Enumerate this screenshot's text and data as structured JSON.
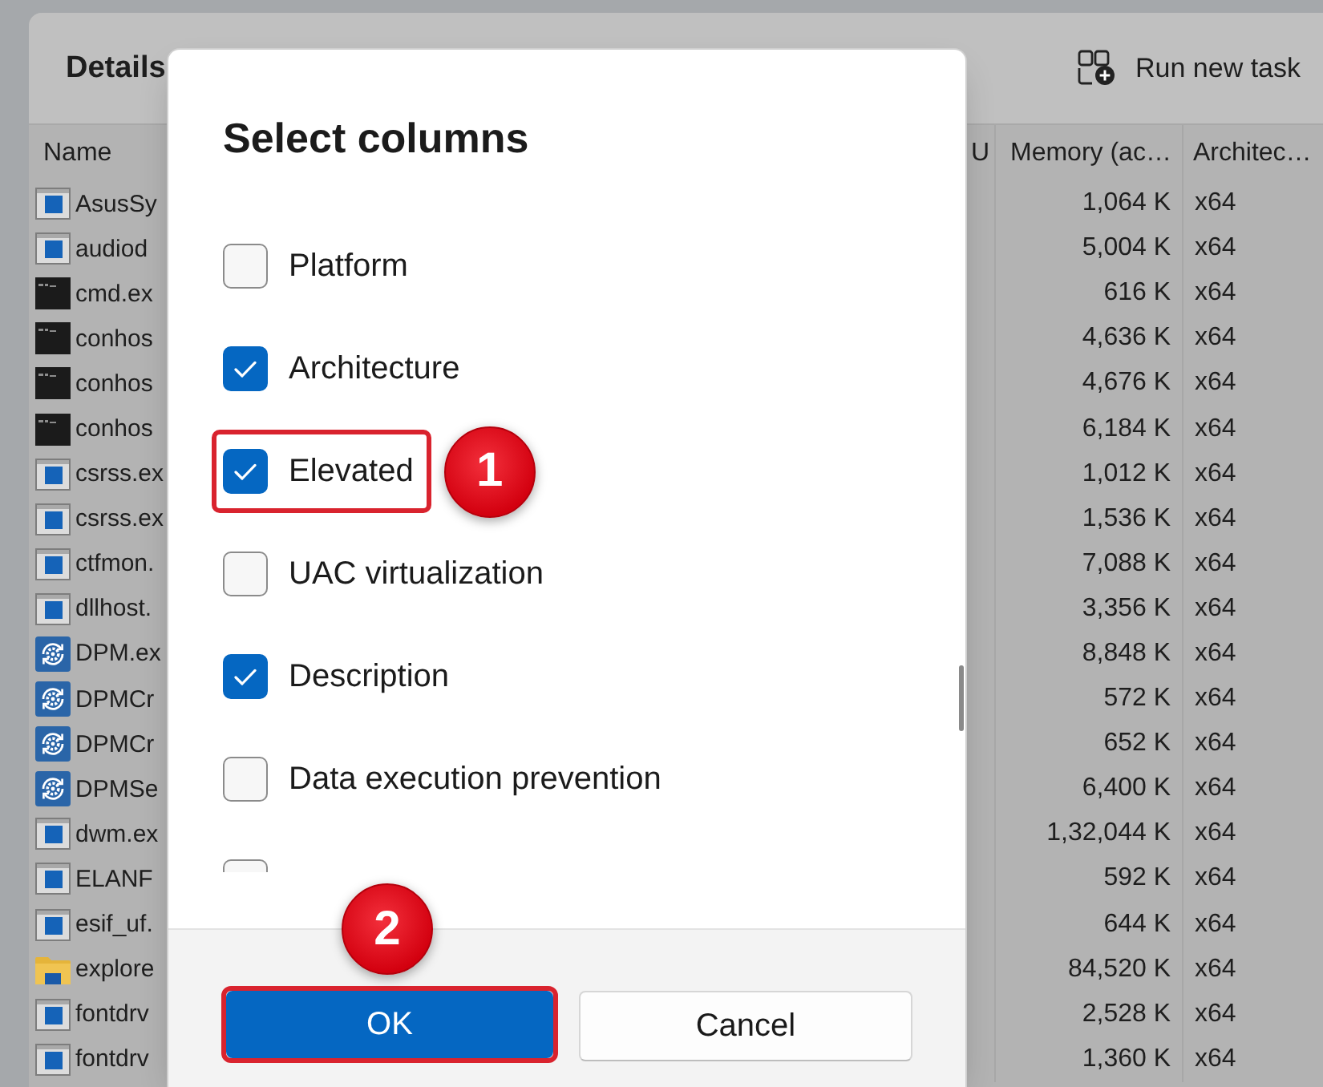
{
  "window": {
    "title": "Details",
    "toolbar": [
      {
        "label": "Run new task"
      }
    ]
  },
  "table": {
    "columns": [
      "Name",
      "U",
      "Memory (ac…",
      "Architec…"
    ],
    "rows": [
      {
        "kind": "app",
        "name": "AsusSy",
        "memory": "1,064 K",
        "architecture": "x64"
      },
      {
        "kind": "app",
        "name": "audiod",
        "memory": "5,004 K",
        "architecture": "x64"
      },
      {
        "kind": "console",
        "name": "cmd.ex",
        "memory": "616 K",
        "architecture": "x64"
      },
      {
        "kind": "console",
        "name": "conhos",
        "memory": "4,636 K",
        "architecture": "x64"
      },
      {
        "kind": "console",
        "name": "conhos",
        "memory": "4,676 K",
        "architecture": "x64"
      },
      {
        "kind": "console",
        "name": "conhos",
        "memory": "6,184 K",
        "architecture": "x64"
      },
      {
        "kind": "app",
        "name": "csrss.ex",
        "memory": "1,012 K",
        "architecture": "x64"
      },
      {
        "kind": "app",
        "name": "csrss.ex",
        "memory": "1,536 K",
        "architecture": "x64"
      },
      {
        "kind": "app",
        "name": "ctfmon.",
        "memory": "7,088 K",
        "architecture": "x64"
      },
      {
        "kind": "app",
        "name": "dllhost.",
        "memory": "3,356 K",
        "architecture": "x64"
      },
      {
        "kind": "service",
        "name": "DPM.ex",
        "memory": "8,848 K",
        "architecture": "x64"
      },
      {
        "kind": "service",
        "name": "DPMCr",
        "memory": "572 K",
        "architecture": "x64"
      },
      {
        "kind": "service",
        "name": "DPMCr",
        "memory": "652 K",
        "architecture": "x64"
      },
      {
        "kind": "service",
        "name": "DPMSe",
        "memory": "6,400 K",
        "architecture": "x64"
      },
      {
        "kind": "app",
        "name": "dwm.ex",
        "memory": "1,32,044 K",
        "architecture": "x64"
      },
      {
        "kind": "app",
        "name": "ELANF",
        "memory": "592 K",
        "architecture": "x64"
      },
      {
        "kind": "app",
        "name": "esif_uf.",
        "memory": "644 K",
        "architecture": "x64"
      },
      {
        "kind": "folder",
        "name": "explore",
        "memory": "84,520 K",
        "architecture": "x64"
      },
      {
        "kind": "app",
        "name": "fontdrv",
        "memory": "2,528 K",
        "architecture": "x64"
      },
      {
        "kind": "app",
        "name": "fontdrv",
        "memory": "1,360 K",
        "architecture": "x64"
      }
    ]
  },
  "dialog": {
    "title": "Select columns",
    "options": [
      {
        "label": "Platform",
        "checked": false,
        "highlighted": false
      },
      {
        "label": "Architecture",
        "checked": true,
        "highlighted": false
      },
      {
        "label": "Elevated",
        "checked": true,
        "highlighted": true,
        "callout": "1"
      },
      {
        "label": "UAC virtualization",
        "checked": false,
        "highlighted": false
      },
      {
        "label": "Description",
        "checked": true,
        "highlighted": false
      },
      {
        "label": "Data execution prevention",
        "checked": false,
        "highlighted": false
      },
      {
        "checked": false
      }
    ],
    "buttons": [
      {
        "label": "OK",
        "kind": "primary",
        "highlighted": true,
        "callout": "2"
      },
      {
        "label": "Cancel",
        "kind": "secondary",
        "highlighted": false
      }
    ]
  }
}
